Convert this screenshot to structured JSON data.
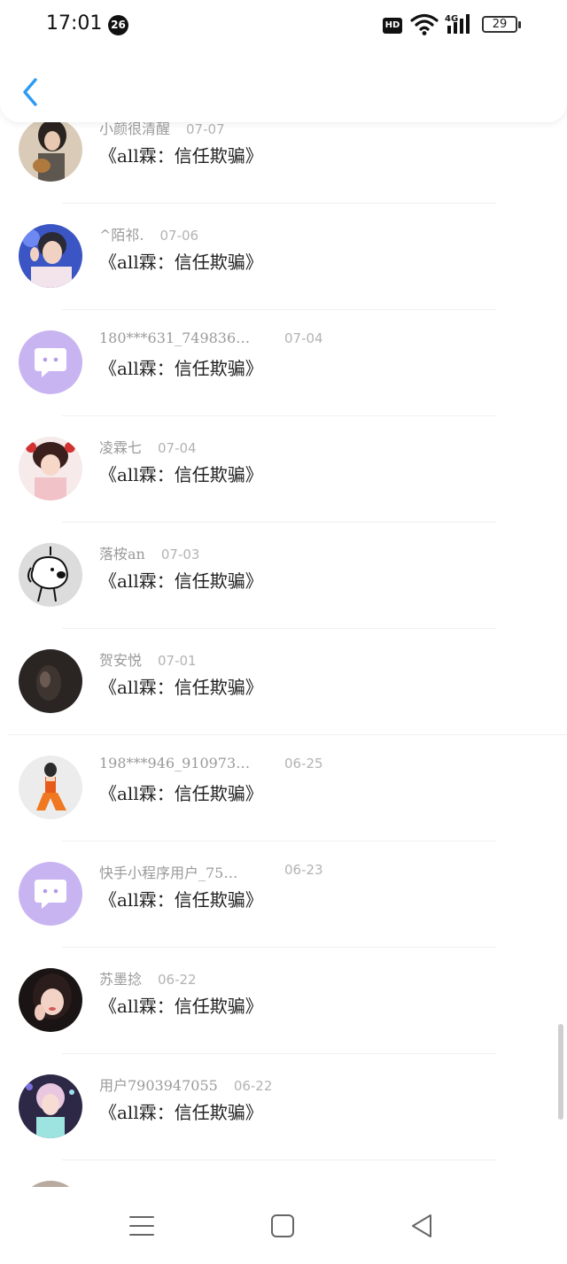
{
  "status_bar": {
    "time": "17:01",
    "notification_count": "26",
    "hd_label": "HD",
    "network": "4G",
    "battery": "29"
  },
  "header": {
    "back_icon": "chevron-left-icon",
    "accent": "#2b9af3"
  },
  "comments": [
    {
      "name": "小颜很清醒",
      "date": "07-07",
      "text": "《all霖：信任欺骗》",
      "avatar": "photo"
    },
    {
      "name": "^陌祁.",
      "date": "07-06",
      "text": "《all霖：信任欺骗》",
      "avatar": "photo"
    },
    {
      "name": "180***631_749836…",
      "date": "07-04",
      "text": "《all霖：信任欺骗》",
      "avatar": "default-chat-icon"
    },
    {
      "name": "凌霖七",
      "date": "07-04",
      "text": "《all霖：信任欺骗》",
      "avatar": "photo"
    },
    {
      "name": "落桉an",
      "date": "07-03",
      "text": "《all霖：信任欺骗》",
      "avatar": "cartoon-dog"
    },
    {
      "name": "贺安悦",
      "date": "07-01",
      "text": "《all霖：信任欺骗》",
      "avatar": "photo-dark"
    },
    {
      "name": "198***946_910973…",
      "date": "06-25",
      "text": "《all霖：信任欺骗》",
      "avatar": "photo"
    },
    {
      "name": "快手小程序用户_75…",
      "date": "06-23",
      "text": "《all霖：信任欺骗》",
      "avatar": "default-chat-icon"
    },
    {
      "name": "苏墨捻",
      "date": "06-22",
      "text": "《all霖：信任欺骗》",
      "avatar": "photo"
    },
    {
      "name": "用户7903947055",
      "date": "06-22",
      "text": "《all霖：信任欺骗》",
      "avatar": "photo"
    }
  ],
  "nav": [
    "menu-icon",
    "home-square-icon",
    "back-triangle-icon"
  ]
}
